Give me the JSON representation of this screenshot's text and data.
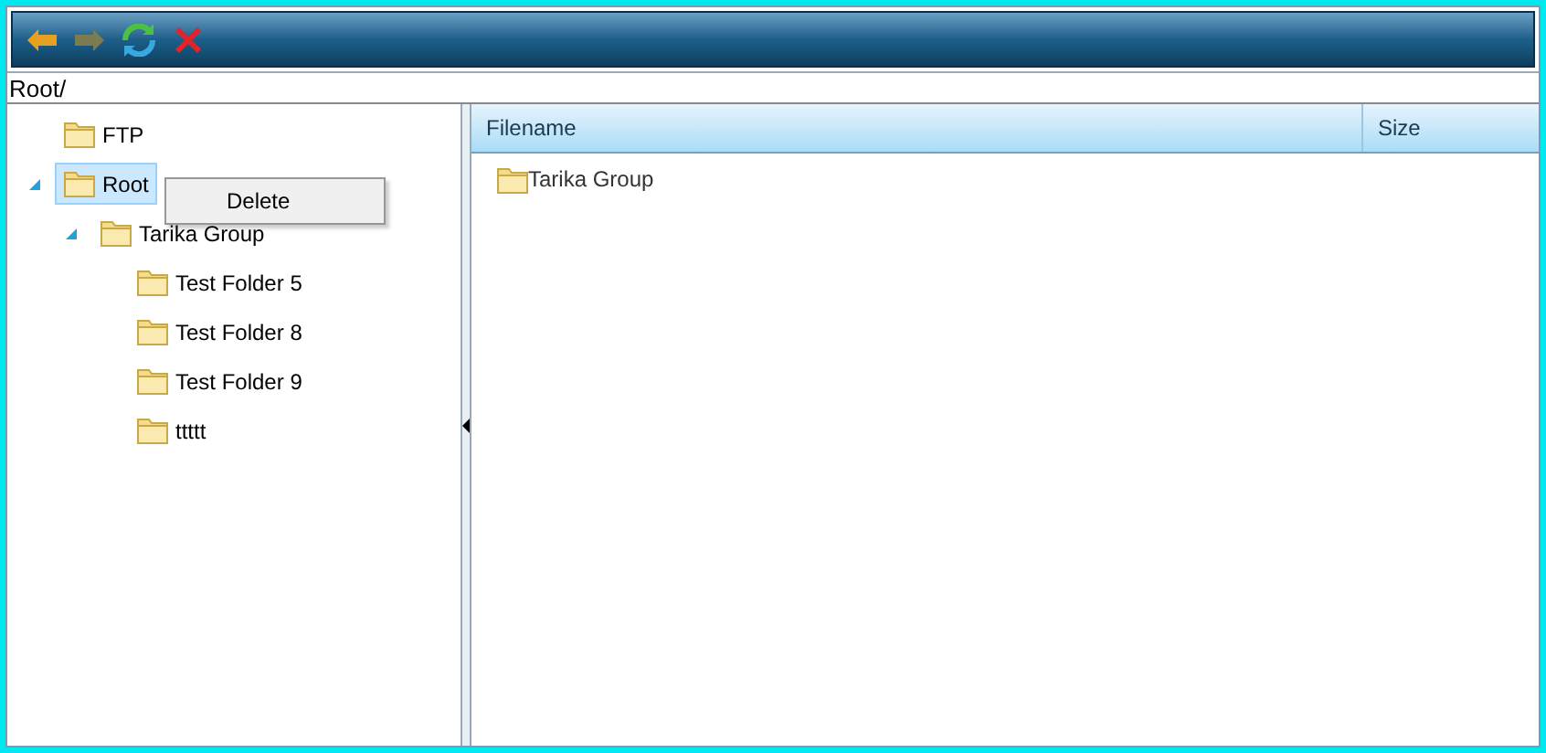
{
  "toolbar": [
    {
      "kind": "back",
      "disabled": false
    },
    {
      "kind": "forward",
      "disabled": true
    },
    {
      "kind": "refresh",
      "disabled": false
    },
    {
      "kind": "delete",
      "disabled": false
    }
  ],
  "path": "Root/",
  "tree": [
    {
      "label": "FTP",
      "selected": false
    },
    {
      "label": "Root",
      "selected": true,
      "expanded": true,
      "children": [
        {
          "label": "Tarika Group",
          "selected": false,
          "expanded": true,
          "children": [
            {
              "label": "Test Folder 5",
              "selected": false
            },
            {
              "label": "Test Folder 8",
              "selected": false
            },
            {
              "label": "Test Folder 9",
              "selected": false
            },
            {
              "label": "ttttt",
              "selected": false
            }
          ]
        }
      ]
    }
  ],
  "context_menu": [
    "Delete"
  ],
  "file_list": {
    "columns": [
      "Filename",
      "Size"
    ],
    "rows": [
      {
        "filename": "Tarika Group"
      }
    ]
  }
}
